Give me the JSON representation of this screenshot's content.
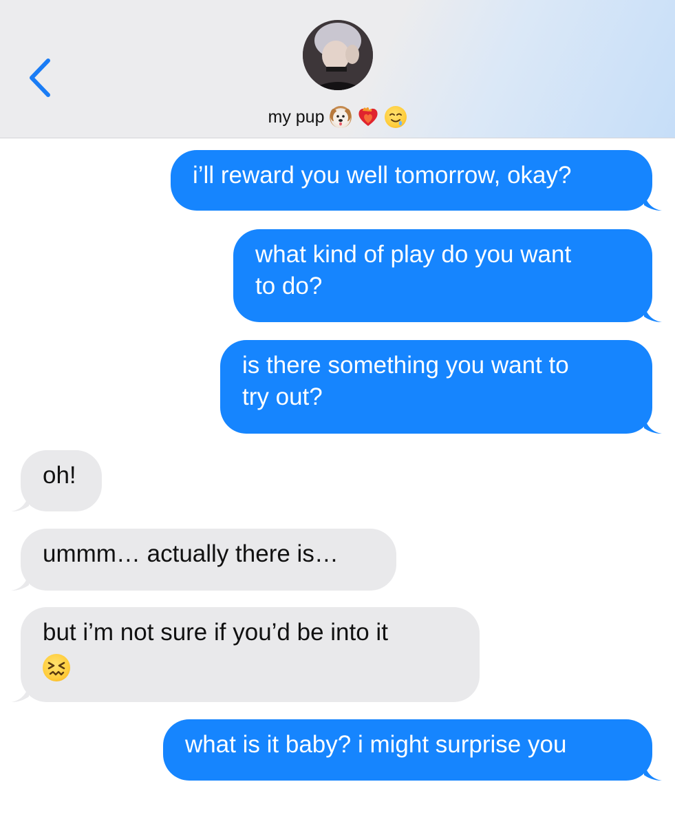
{
  "header": {
    "contact_name": "my pup",
    "contact_emojis": [
      "dog-face-emoji",
      "heart-on-fire-emoji",
      "drooling-face-emoji"
    ]
  },
  "messages": [
    {
      "from": "me",
      "text": "i’ll reward you well tomorrow, okay?"
    },
    {
      "from": "me",
      "lines": [
        "what kind of play do you want",
        "to do?"
      ]
    },
    {
      "from": "me",
      "lines": [
        "is there something you want to",
        "try out?"
      ]
    },
    {
      "from": "them",
      "text": "oh!"
    },
    {
      "from": "them",
      "text": "ummm… actually there is…"
    },
    {
      "from": "them",
      "text": "but i’m not sure if you’d be into it",
      "emoji": "confounded-face-emoji"
    },
    {
      "from": "me",
      "text": "what is it baby? i might surprise you"
    }
  ],
  "colors": {
    "sent_bubble": "#1685fe",
    "received_bubble": "#e9e9eb",
    "accent": "#1a7cf5"
  }
}
